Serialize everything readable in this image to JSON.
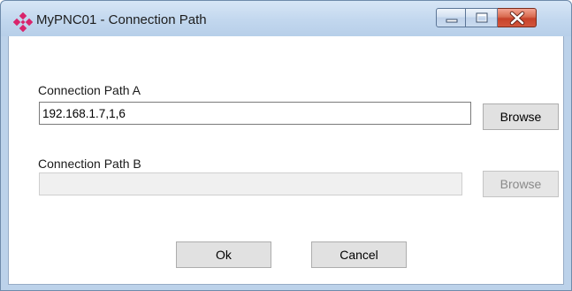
{
  "window": {
    "title": "MyPNC01 - Connection Path",
    "icon": "diamond-cluster-icon",
    "controls": {
      "minimize": "minimize-icon",
      "maximize": "maximize-icon",
      "close": "close-icon"
    }
  },
  "form": {
    "path_a": {
      "label": "Connection Path A",
      "value": "192.168.1.7,1,6",
      "browse_label": "Browse"
    },
    "path_b": {
      "label": "Connection Path B",
      "value": "",
      "browse_label": "Browse"
    }
  },
  "buttons": {
    "ok": "Ok",
    "cancel": "Cancel"
  },
  "colors": {
    "icon_accent": "#d9246c",
    "close_button": "#c7422a",
    "titlebar": "#c2d7ee"
  }
}
